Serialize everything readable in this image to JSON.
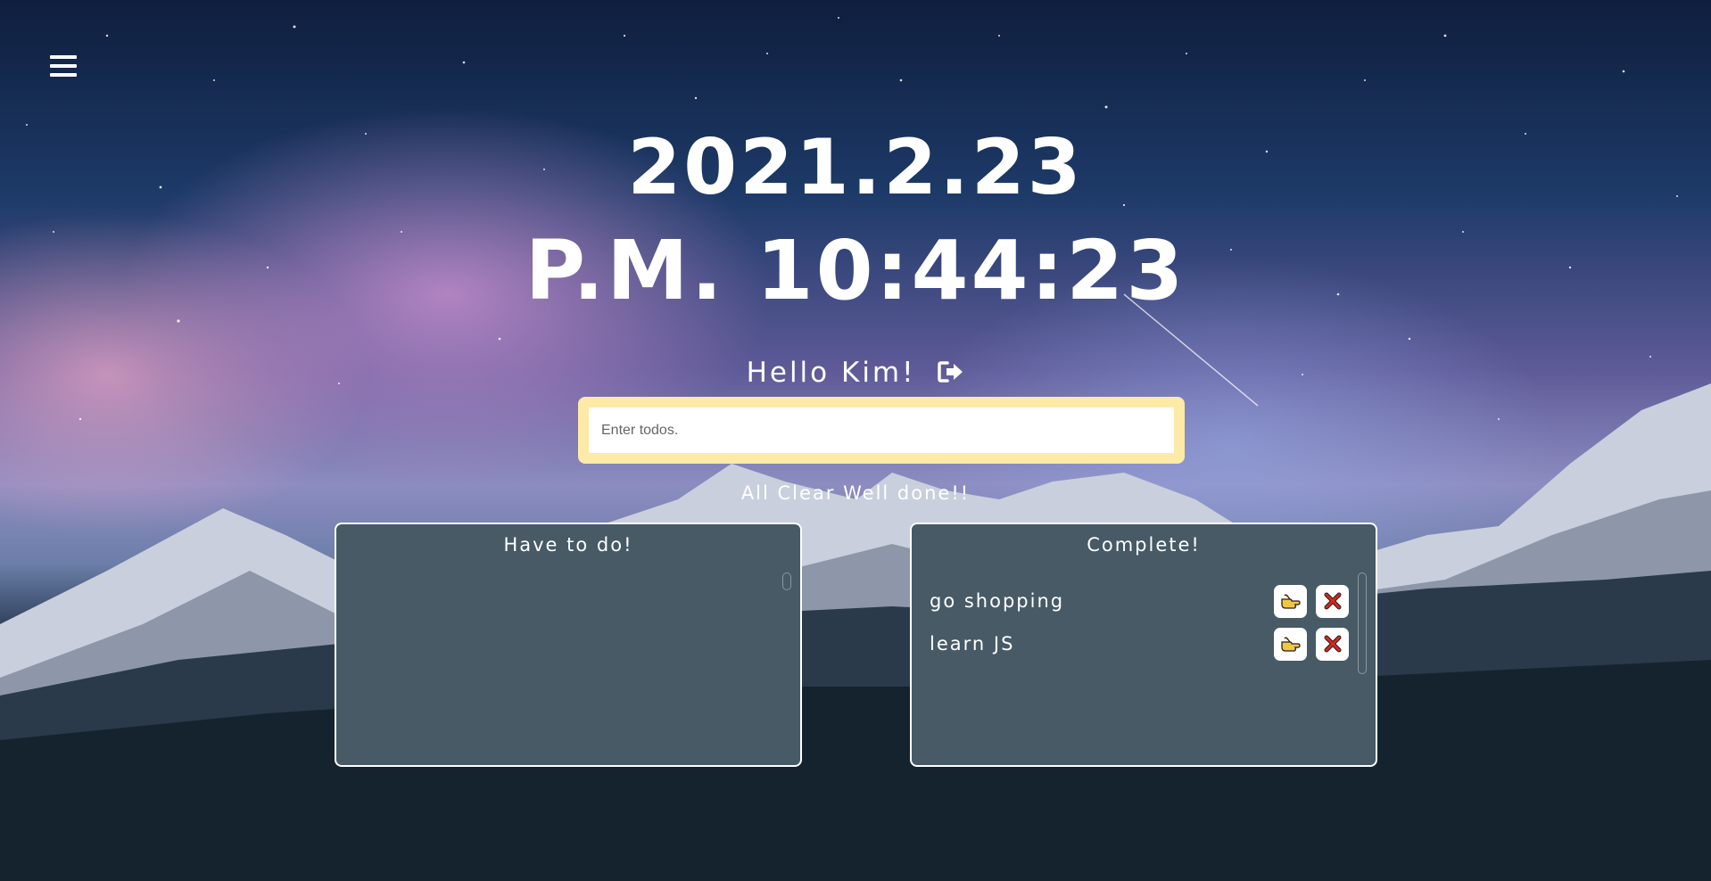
{
  "header": {
    "menu_icon": "hamburger-menu-icon",
    "date": "2021.2.23",
    "time": "P.M. 10:44:23",
    "greeting": "Hello Kim!",
    "logout_icon": "sign-out-icon"
  },
  "form": {
    "placeholder": "Enter todos.",
    "value": ""
  },
  "status_message": "All Clear Well done!!",
  "panels": {
    "todo": {
      "title": "Have to do!",
      "items": []
    },
    "complete": {
      "title": "Complete!",
      "items": [
        {
          "text": "go shopping",
          "restore_icon": "pointing-hand-icon",
          "delete_icon": "cross-mark-icon"
        },
        {
          "text": "learn JS",
          "restore_icon": "pointing-hand-icon",
          "delete_icon": "cross-mark-icon"
        }
      ]
    }
  },
  "colors": {
    "form_border": "#fdeaa7",
    "panel_bg": "#475a66",
    "panel_border": "#ffffff",
    "delete_red": "#d9261c",
    "hand_yellow": "#f5c542"
  }
}
